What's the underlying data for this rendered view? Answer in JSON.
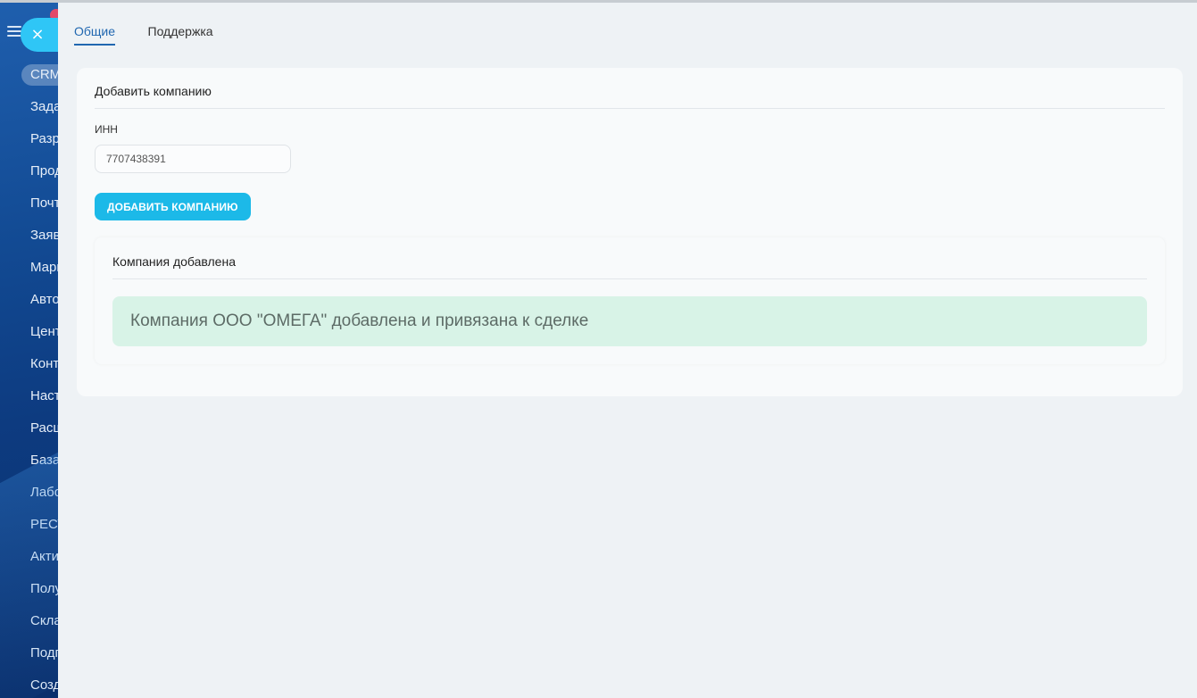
{
  "sidebar": {
    "items": [
      {
        "label": "CRM",
        "active": true
      },
      {
        "label": "Задачи"
      },
      {
        "label": "Разработка"
      },
      {
        "label": "Продажи"
      },
      {
        "label": "Почта"
      },
      {
        "label": "Заявки"
      },
      {
        "label": "Маркетинг"
      },
      {
        "label": "Автоматизация"
      },
      {
        "label": "Центр"
      },
      {
        "label": "Контакты"
      },
      {
        "label": "Настройки"
      },
      {
        "label": "Расширения"
      },
      {
        "label": "База"
      },
      {
        "label": "Лаборатория"
      },
      {
        "label": "РЕСТ"
      },
      {
        "label": "Активности"
      },
      {
        "label": "Получатели"
      },
      {
        "label": "Склад"
      },
      {
        "label": "Подписки"
      },
      {
        "label": "Создать"
      }
    ],
    "close_glyph": "×"
  },
  "tabs": [
    {
      "label": "Общие",
      "active": true
    },
    {
      "label": "Поддержка",
      "active": false
    }
  ],
  "panel": {
    "title": "Добавить компанию",
    "inn_label": "ИНН",
    "inn_value": "7707438391",
    "add_button_label": "ДОБАВИТЬ КОМПАНИЮ"
  },
  "result": {
    "title": "Компания добавлена",
    "message": "Компания ООО \"ОМЕГА\" добавлена и привязана к сделке"
  },
  "colors": {
    "accent": "#1cb9e8",
    "tab_active": "#2067b0",
    "success_bg": "#d8f3e7"
  }
}
